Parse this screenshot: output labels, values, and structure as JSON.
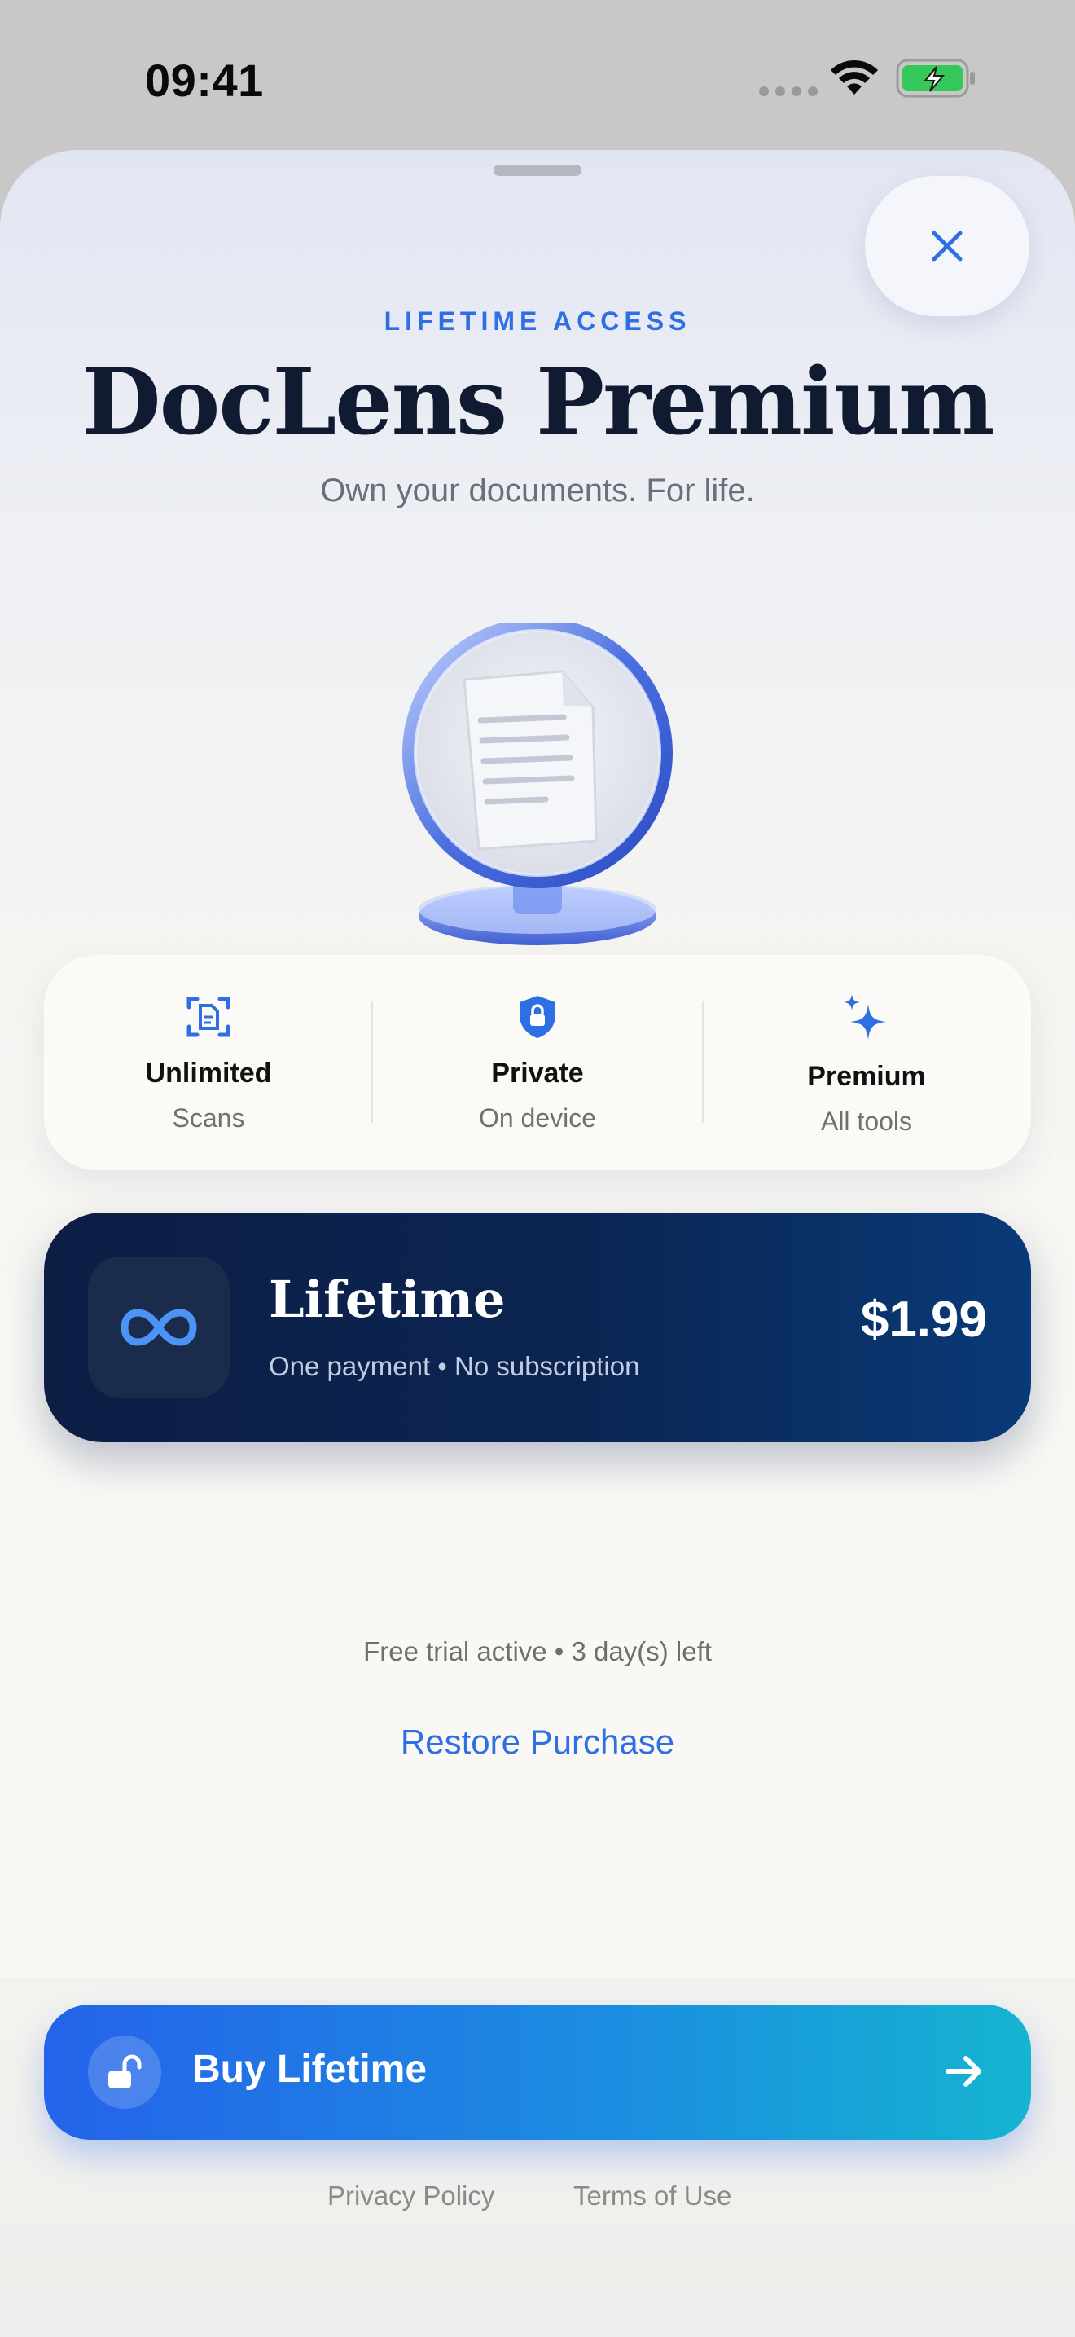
{
  "status_bar": {
    "time": "09:41"
  },
  "header": {
    "eyebrow": "LIFETIME ACCESS",
    "title": "DocLens Premium",
    "subtitle": "Own your documents. For life."
  },
  "features": [
    {
      "icon": "scan-document-icon",
      "title": "Unlimited",
      "subtitle": "Scans"
    },
    {
      "icon": "shield-lock-icon",
      "title": "Private",
      "subtitle": "On device"
    },
    {
      "icon": "sparkles-icon",
      "title": "Premium",
      "subtitle": "All tools"
    }
  ],
  "plan": {
    "icon": "infinity-icon",
    "name": "Lifetime",
    "description": "One payment • No subscription",
    "price": "$1.99"
  },
  "trial_status": "Free trial active • 3 day(s) left",
  "restore_label": "Restore Purchase",
  "cta": {
    "label": "Buy Lifetime",
    "icon": "unlock-icon",
    "arrow_icon": "arrow-right-icon"
  },
  "footer": {
    "privacy": "Privacy Policy",
    "terms": "Terms of Use"
  },
  "colors": {
    "accent": "#2f6fe4",
    "plan_background": "#0b2552",
    "cta_start": "#2563ea",
    "cta_end": "#15b4d0",
    "battery": "#34c759"
  }
}
